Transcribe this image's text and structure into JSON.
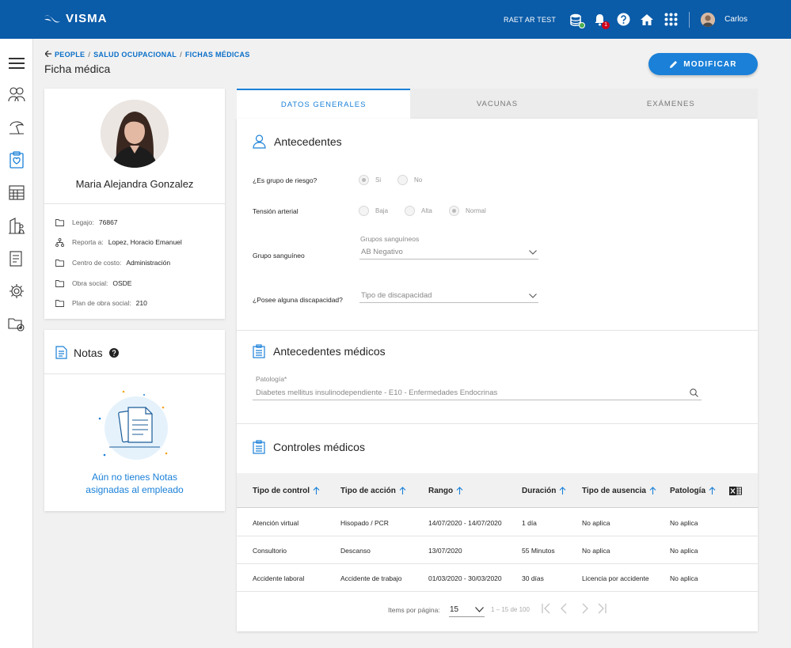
{
  "topbar": {
    "brand": "VISMA",
    "company": "RAET AR TEST",
    "notifications_count": "1",
    "user": "Carlos"
  },
  "breadcrumb": {
    "items": [
      "PEOPLE",
      "SALUD OCUPACIONAL",
      "FICHAS MÉDICAS"
    ],
    "separator": "/"
  },
  "page": {
    "title": "Ficha médica",
    "modify_label": "MODIFICAR"
  },
  "profile": {
    "name": "Maria Alejandra Gonzalez",
    "fields": [
      {
        "label": "Legajo:",
        "value": "76867",
        "icon": "folder-icon"
      },
      {
        "label": "Reporta a:",
        "value": "Lopez, Horacio Emanuel",
        "icon": "org-chart-icon"
      },
      {
        "label": "Centro de costo:",
        "value": "Administración",
        "icon": "folder-icon"
      },
      {
        "label": "Obra social:",
        "value": "OSDE",
        "icon": "folder-icon"
      },
      {
        "label": "Plan de obra social:",
        "value": "210",
        "icon": "folder-icon"
      }
    ]
  },
  "notes": {
    "title": "Notas",
    "empty_line1": "Aún no tienes Notas",
    "empty_line2": "asignadas al empleado"
  },
  "tabs": [
    {
      "label": "DATOS GENERALES",
      "active": true
    },
    {
      "label": "VACUNAS",
      "active": false
    },
    {
      "label": "EXÁMENES",
      "active": false
    }
  ],
  "antecedentes": {
    "title": "Antecedentes",
    "riesgo_label": "¿Es grupo de riesgo?",
    "riesgo_options": [
      "Si",
      "No"
    ],
    "tension_label": "Tensión arterial",
    "tension_options": [
      "Baja",
      "Alta",
      "Normal"
    ],
    "grupo_label": "Grupo sanguíneo",
    "grupo_field_label": "Grupos sanguíneos",
    "grupo_value": "AB Negativo",
    "discapacidad_label": "¿Posee alguna discapacidad?",
    "discapacidad_placeholder": "Tipo de discapacidad"
  },
  "antecedentes_medicos": {
    "title": "Antecedentes médicos",
    "patologia_label": "Patología*",
    "patologia_value": "Diabetes mellitus insulinodependiente - E10 - Enfermedades Endocrinas"
  },
  "controles": {
    "title": "Controles médicos",
    "columns": [
      "Tipo de control",
      "Tipo de acción",
      "Rango",
      "Duración",
      "Tipo de ausencia",
      "Patología"
    ],
    "rows": [
      [
        "Atención virtual",
        "Hisopado / PCR",
        "14/07/2020 - 14/07/2020",
        "1 día",
        "No aplica",
        "No aplica"
      ],
      [
        "Consultorio",
        "Descanso",
        "13/07/2020",
        "55 Minutos",
        "No aplica",
        "No aplica"
      ],
      [
        "Accidente laboral",
        "Accidente de trabajo",
        "01/03/2020 - 30/03/2020",
        "30 días",
        "Licencia por accidente",
        "No aplica"
      ]
    ],
    "pager": {
      "items_label": "Items por página:",
      "page_size": "15",
      "range": "1 – 15 de 100"
    }
  }
}
